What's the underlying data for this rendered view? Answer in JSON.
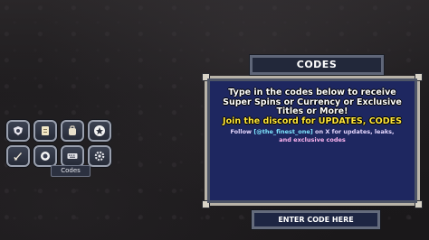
{
  "sidebar": {
    "buttons": [
      {
        "icon": "shield-crest-icon"
      },
      {
        "icon": "scroll-icon"
      },
      {
        "icon": "backpack-icon"
      },
      {
        "icon": "star-icon"
      },
      {
        "icon": "sword-icon"
      },
      {
        "icon": "gem-icon"
      },
      {
        "icon": "keyboard-icon"
      },
      {
        "icon": "gear-icon"
      }
    ],
    "codes_label": "Codes"
  },
  "codes_panel": {
    "title": "CODES",
    "instructions": [
      "Type in the codes below to receive",
      "Super Spins or Currency or Exclusive",
      "Titles or More!"
    ],
    "discord_line": [
      "Join the discord for UPDATES, CODES"
    ],
    "follow_prefix": "Follow",
    "follow_handle": "[@the_finest_one]",
    "follow_suffix": "on X for updates, leaks,",
    "follow_tail": "and exclusive codes"
  },
  "code_input": {
    "placeholder": "ENTER CODE HERE"
  },
  "colors": {
    "panel_bg": "#1e2760",
    "highlight": "#ffe63a",
    "handle": "#7fe6ff",
    "tail": "#ffb6f2"
  }
}
